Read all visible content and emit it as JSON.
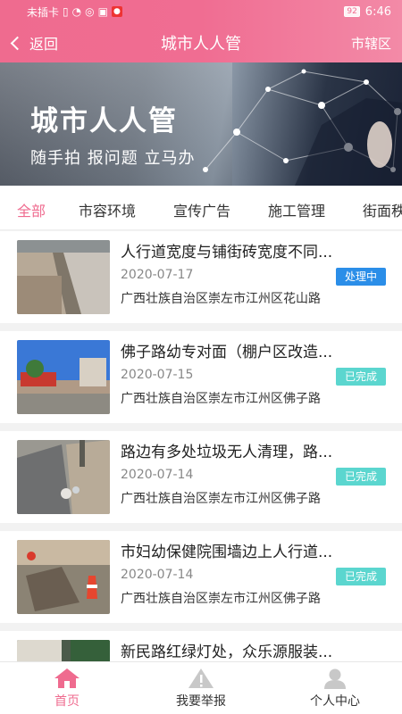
{
  "status_bar": {
    "carrier": "未插卡",
    "battery": "92",
    "time": "6:46"
  },
  "nav": {
    "back_label": "返回",
    "title": "城市人人管",
    "district_label": "市辖区"
  },
  "banner": {
    "title": "城市人人管",
    "subtitle": "随手拍 报问题 立马办"
  },
  "tabs": [
    "全部",
    "市容环境",
    "宣传广告",
    "施工管理",
    "街面秩"
  ],
  "active_tab": "全部",
  "reports": [
    {
      "title": "人行道宽度与铺街砖宽度不同...",
      "date": "2020-07-17",
      "address": "广西壮族自治区崇左市江州区花山路",
      "status": "处理中",
      "status_type": "doing"
    },
    {
      "title": "佛子路幼专对面（棚户区改造...",
      "date": "2020-07-15",
      "address": "广西壮族自治区崇左市江州区佛子路",
      "status": "已完成",
      "status_type": "done"
    },
    {
      "title": "路边有多处垃圾无人清理，路...",
      "date": "2020-07-14",
      "address": "广西壮族自治区崇左市江州区佛子路",
      "status": "已完成",
      "status_type": "done"
    },
    {
      "title": "市妇幼保健院围墙边上人行道...",
      "date": "2020-07-14",
      "address": "广西壮族自治区崇左市江州区佛子路",
      "status": "已完成",
      "status_type": "done"
    },
    {
      "title": "新民路红绿灯处，众乐源服装...",
      "date": "",
      "address": "",
      "status": "",
      "status_type": ""
    }
  ],
  "tabbar": {
    "home": "首页",
    "report": "我要举报",
    "profile": "个人中心"
  },
  "colors": {
    "primary": "#ef6b8f",
    "doing": "#2b8ee8",
    "done": "#5bd6cf"
  }
}
